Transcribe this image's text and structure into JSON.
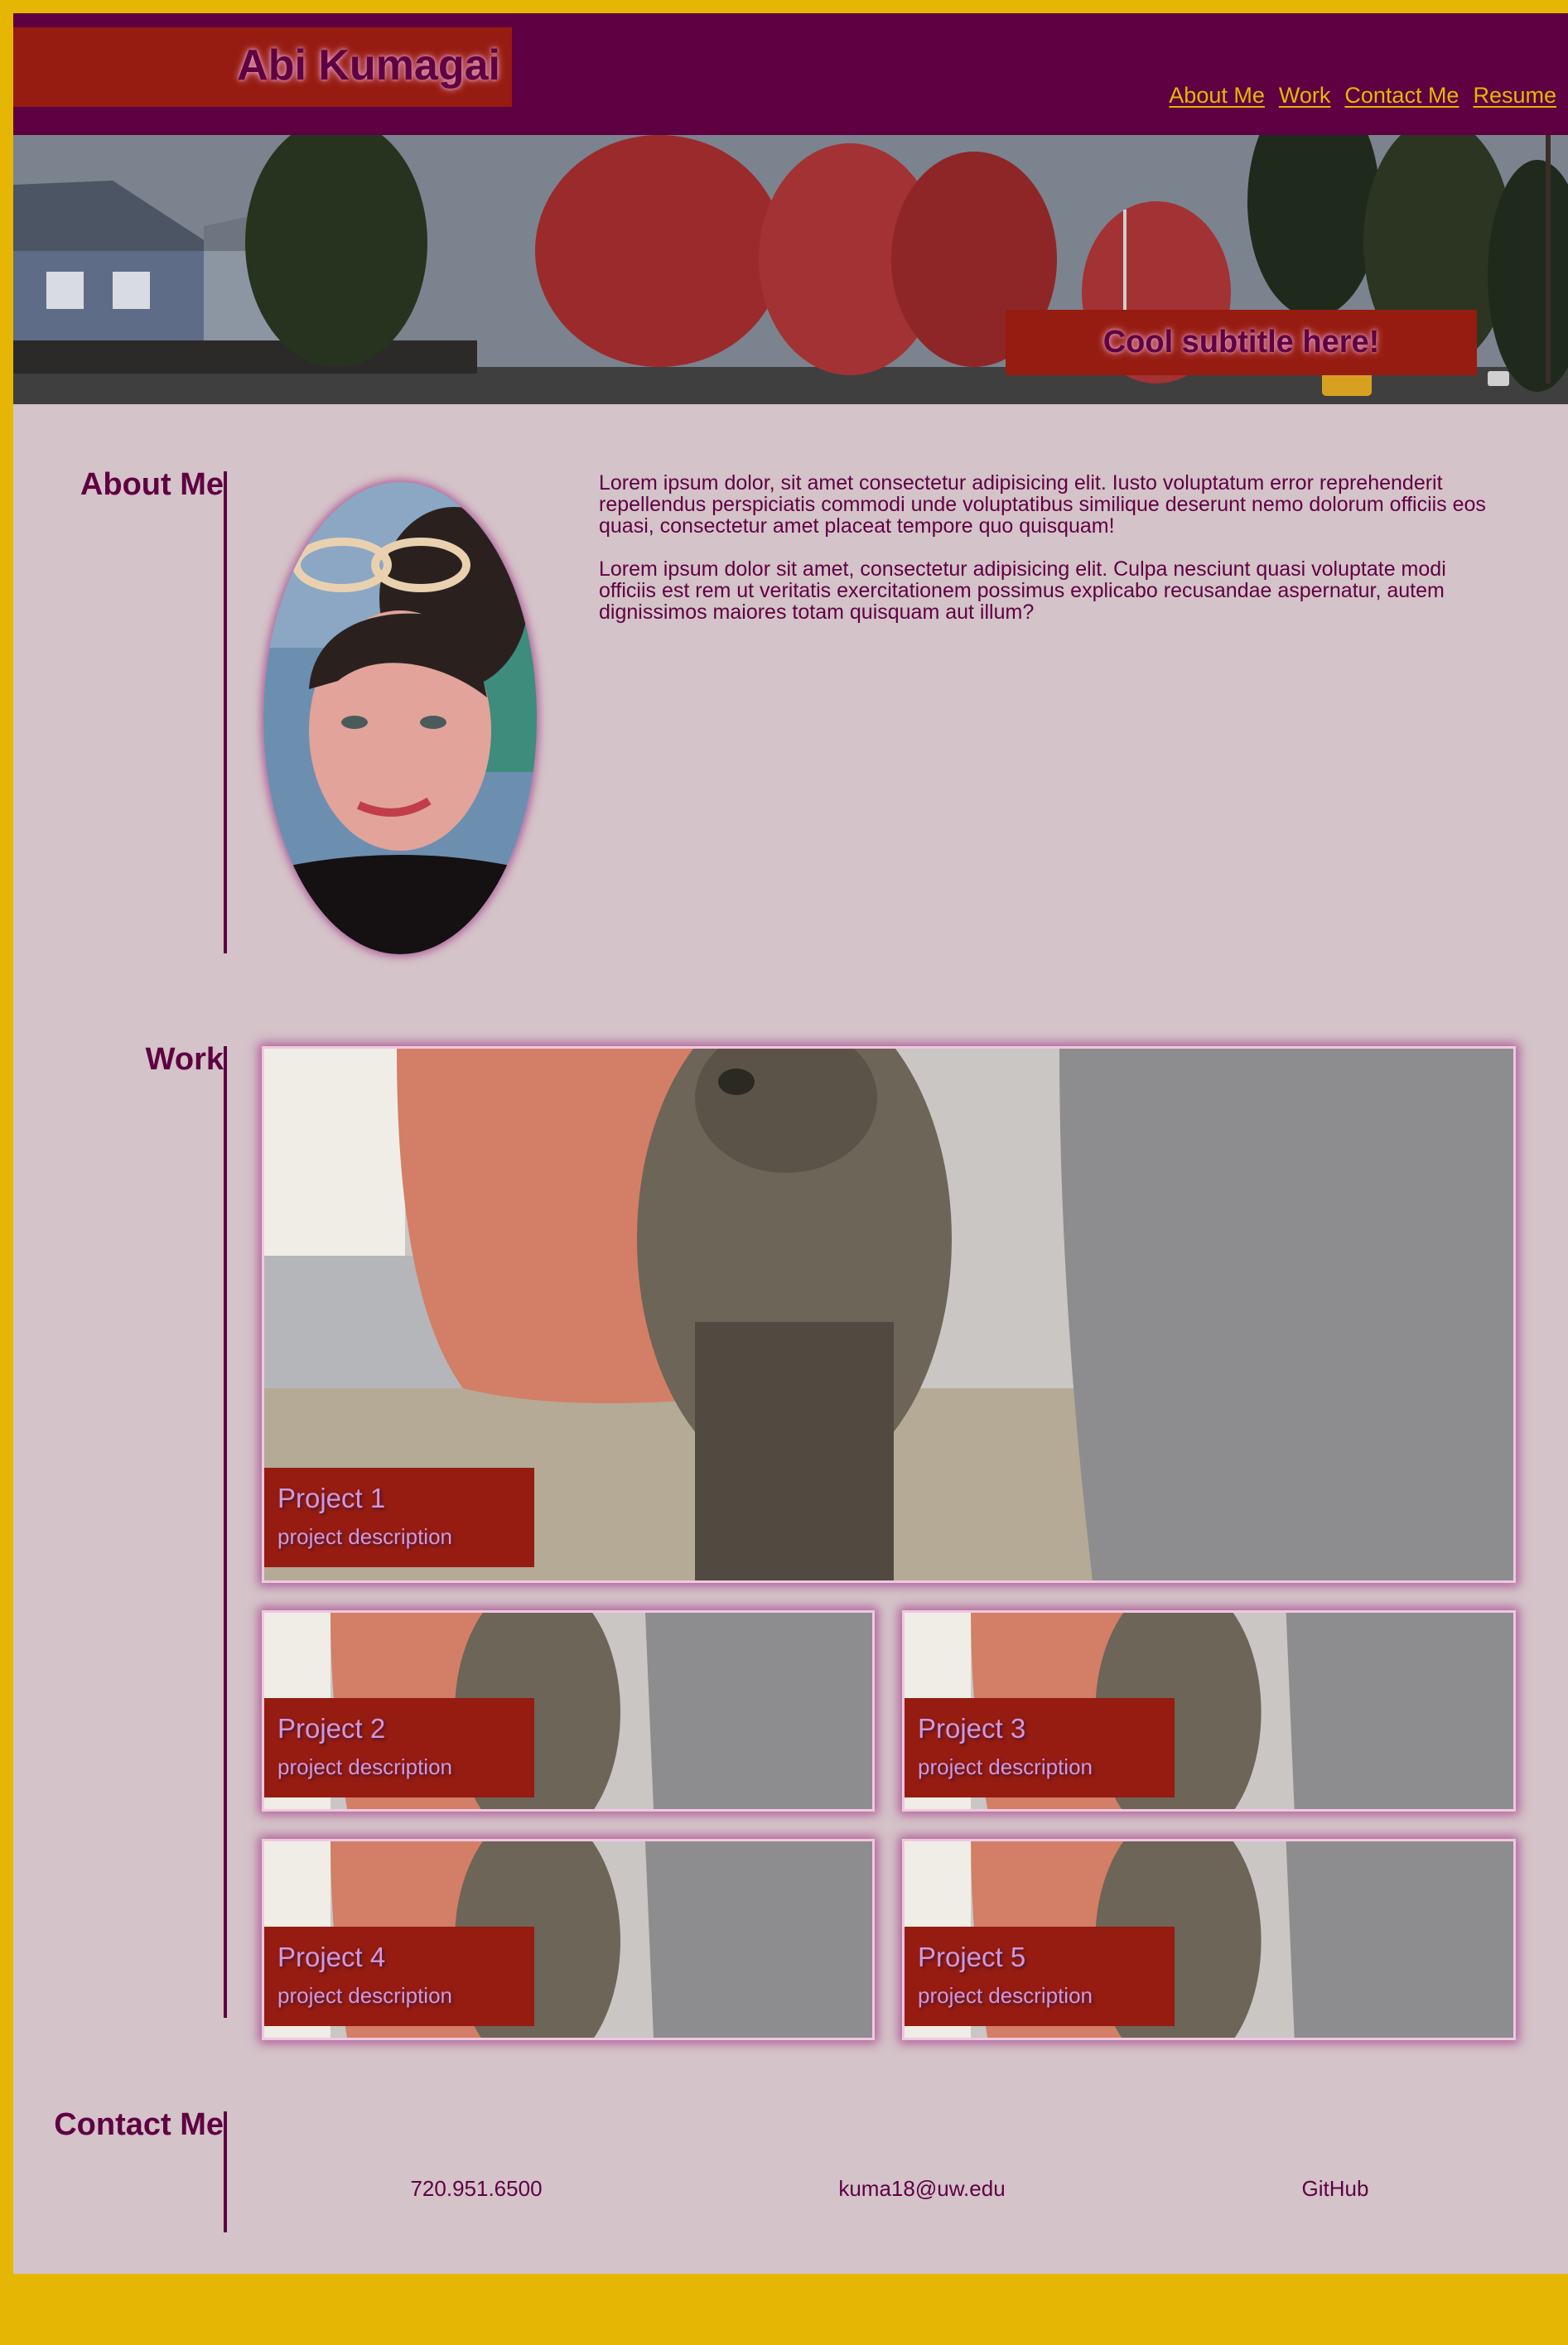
{
  "header": {
    "name": "Abi Kumagai",
    "nav": [
      "About Me",
      "Work",
      "Contact Me",
      "Resume"
    ]
  },
  "hero": {
    "subtitle": "Cool subtitle here!"
  },
  "about": {
    "title": "About Me",
    "paragraphs": [
      "Lorem ipsum dolor, sit amet consectetur adipisicing elit. Iusto voluptatum error reprehenderit repellendus perspiciatis commodi unde voluptatibus similique deserunt nemo dolorum officiis eos quasi, consectetur amet placeat tempore quo quisquam!",
      "Lorem ipsum dolor sit amet, consectetur adipisicing elit. Culpa nesciunt quasi voluptate modi officiis est rem ut veritatis exercitationem possimus explicabo recusandae aspernatur, autem dignissimos maiores totam quisquam aut illum?"
    ]
  },
  "work": {
    "title": "Work",
    "projects": [
      {
        "title": "Project 1",
        "description": "project description"
      },
      {
        "title": "Project 2",
        "description": "project description"
      },
      {
        "title": "Project 3",
        "description": "project description"
      },
      {
        "title": "Project 4",
        "description": "project description"
      },
      {
        "title": "Project 5",
        "description": "project description"
      }
    ]
  },
  "contact": {
    "title": "Contact Me",
    "phone": "720.951.6500",
    "email": "kuma18@uw.edu",
    "github": "GitHub"
  },
  "colors": {
    "border_gold": "#e5b704",
    "plum": "#5f0043",
    "brick_red": "#961b10",
    "background": "#d4c3c8"
  }
}
